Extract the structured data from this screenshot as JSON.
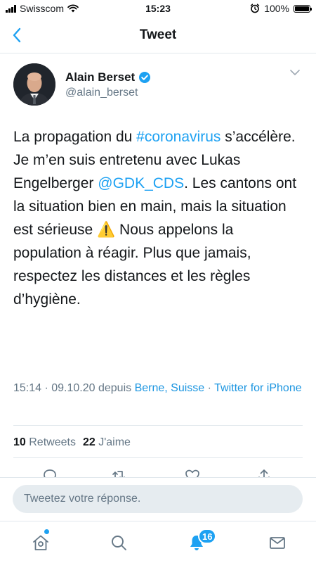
{
  "status_bar": {
    "carrier": "Swisscom",
    "time": "15:23",
    "battery": "100%"
  },
  "nav": {
    "title": "Tweet"
  },
  "author": {
    "name": "Alain Berset",
    "handle": "@alain_berset",
    "verified": true
  },
  "tweet": {
    "text_1": "La propagation du ",
    "hashtag": "#coronavirus",
    "text_2": " s’accélère. Je m’en suis entretenu avec Lukas Engelberger ",
    "mention": "@GDK_CDS",
    "text_3": ". Les cantons ont la situation bien en main, mais la situation est sérieuse ",
    "emoji": "⚠️",
    "text_4": " Nous appelons la population à réagir. Plus que jamais, respectez les distances et les règles d’hygiène."
  },
  "meta": {
    "time": "15:14 · 09.10.20 depuis ",
    "location": "Berne, Suisse",
    "separator": " · ",
    "source": "Twitter for iPhone"
  },
  "stats": {
    "retweets_count": "10",
    "retweets_label": "Retweets",
    "likes_count": "22",
    "likes_label": "J'aime"
  },
  "reply": {
    "placeholder": "Tweetez votre réponse."
  },
  "tab_bar": {
    "notifications_badge": "16"
  },
  "colors": {
    "accent": "#1da1f2",
    "secondary_text": "#657786",
    "border": "#e1e8ed"
  }
}
